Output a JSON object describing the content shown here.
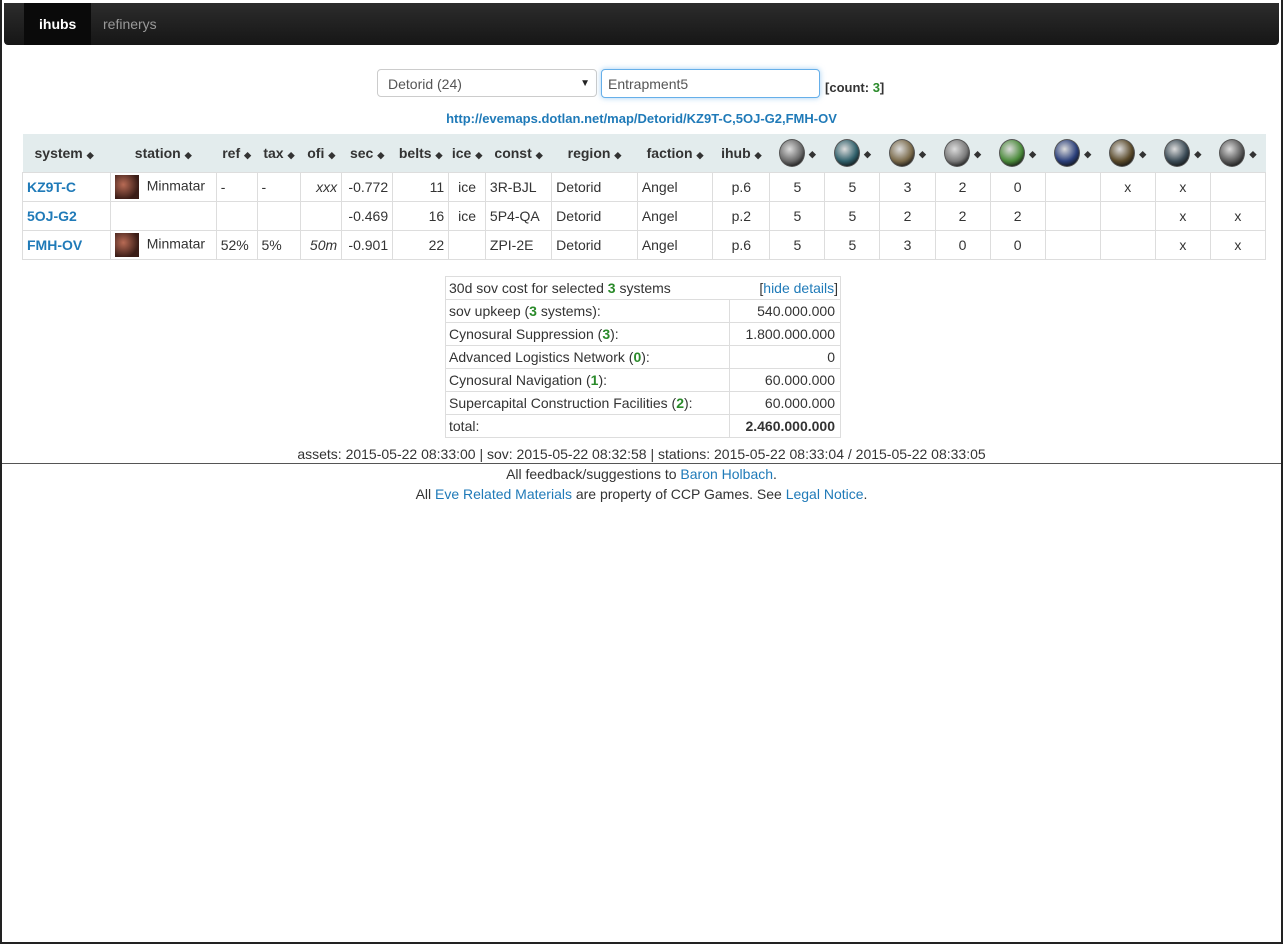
{
  "nav": {
    "items": [
      "ihubs",
      "refinerys"
    ]
  },
  "controls": {
    "region_select": "Detorid (24)",
    "search_value": "Entrapment5",
    "count_label": "count:",
    "count_value": "3"
  },
  "map_link": "http://evemaps.dotlan.net/map/Detorid/KZ9T-C,5OJ-G2,FMH-OV",
  "table": {
    "headers": [
      "system",
      "station",
      "ref",
      "tax",
      "ofi",
      "sec",
      "belts",
      "ice",
      "const",
      "region",
      "faction",
      "ihub"
    ],
    "upgrade_icons": [
      {
        "name": "upgrade-icon-1",
        "color": "#6a6a6a"
      },
      {
        "name": "upgrade-icon-2",
        "color": "#2f5f6a"
      },
      {
        "name": "upgrade-icon-3",
        "color": "#7a6a4a"
      },
      {
        "name": "upgrade-icon-4",
        "color": "#7a7a7a"
      },
      {
        "name": "upgrade-icon-5",
        "color": "#4a8a3a"
      },
      {
        "name": "upgrade-icon-6",
        "color": "#2a3f7a"
      },
      {
        "name": "upgrade-icon-7",
        "color": "#5a4a2a"
      },
      {
        "name": "upgrade-icon-8",
        "color": "#3a4a55"
      },
      {
        "name": "upgrade-icon-9",
        "color": "#5a5a5a"
      }
    ],
    "rows": [
      {
        "system": "KZ9T-C",
        "has_station": true,
        "station": "Minmatar",
        "ref": "-",
        "tax": "-",
        "ofi": "xxx",
        "sec": "-0.772",
        "belts": "11",
        "ice": "ice",
        "const": "3R-BJL",
        "region": "Detorid",
        "faction": "Angel",
        "ihub": "p.6",
        "upgrades": [
          "5",
          "5",
          "3",
          "2",
          "0",
          "",
          "x",
          "x",
          ""
        ]
      },
      {
        "system": "5OJ-G2",
        "has_station": false,
        "station": "",
        "ref": "",
        "tax": "",
        "ofi": "",
        "sec": "-0.469",
        "belts": "16",
        "ice": "ice",
        "const": "5P4-QA",
        "region": "Detorid",
        "faction": "Angel",
        "ihub": "p.2",
        "upgrades": [
          "5",
          "5",
          "2",
          "2",
          "2",
          "",
          "",
          "x",
          "x"
        ]
      },
      {
        "system": "FMH-OV",
        "has_station": true,
        "station": "Minmatar",
        "ref": "52%",
        "tax": "5%",
        "ofi": "50m",
        "sec": "-0.901",
        "belts": "22",
        "ice": "",
        "const": "ZPI-2E",
        "region": "Detorid",
        "faction": "Angel",
        "ihub": "p.6",
        "upgrades": [
          "5",
          "5",
          "3",
          "0",
          "0",
          "",
          "",
          "x",
          "x"
        ]
      }
    ]
  },
  "sov": {
    "header_pre": "30d sov cost for selected ",
    "header_count": "3",
    "header_post": " systems",
    "hide_link": "hide details",
    "rows": [
      {
        "label": "sov upkeep",
        "count": "3",
        "suffix": " systems",
        "value": "540.000.000"
      },
      {
        "label": "Cynosural Suppression",
        "count": "3",
        "suffix": "",
        "value": "1.800.000.000"
      },
      {
        "label": "Advanced Logistics Network",
        "count": "0",
        "suffix": "",
        "value": "0"
      },
      {
        "label": "Cynosural Navigation",
        "count": "1",
        "suffix": "",
        "value": "60.000.000"
      },
      {
        "label": "Supercapital Construction Facilities",
        "count": "2",
        "suffix": "",
        "value": "60.000.000"
      }
    ],
    "total_label": "total:",
    "total_value": "2.460.000.000"
  },
  "timestamps": "assets: 2015-05-22 08:33:00 | sov: 2015-05-22 08:32:58 | stations: 2015-05-22 08:33:04 / 2015-05-22 08:33:05",
  "footer": {
    "line1_pre": "All feedback/suggestions to ",
    "line1_link": "Baron Holbach",
    "line1_post": ".",
    "line2_pre": "All ",
    "line2_link1": "Eve Related Materials",
    "line2_mid": " are property of CCP Games. See ",
    "line2_link2": "Legal Notice",
    "line2_post": "."
  }
}
